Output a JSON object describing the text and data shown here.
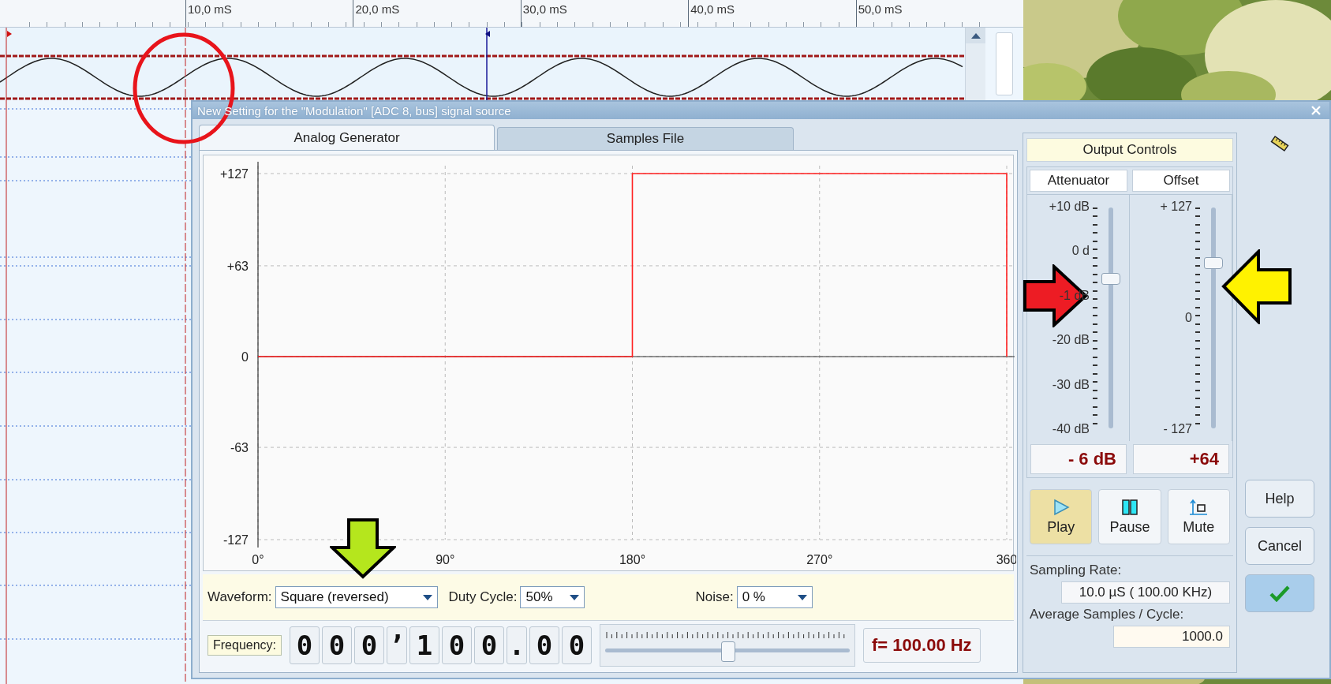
{
  "viewer": {
    "ruler_labels": [
      "10,0 mS",
      "20,0 mS",
      "30,0 mS",
      "40,0 mS",
      "50,0 mS"
    ]
  },
  "dialog": {
    "title": "New Setting for the \"Modulation\" [ADC 8, bus] signal source",
    "tabs": [
      {
        "label": "Analog Generator",
        "selected": true
      },
      {
        "label": "Samples File",
        "selected": false
      }
    ],
    "chart_data": {
      "type": "line",
      "x": [
        0,
        180,
        180,
        360,
        360
      ],
      "grid": true,
      "series": [
        {
          "color": "#ff2020",
          "values": [
            0,
            0,
            127,
            127,
            0
          ]
        }
      ],
      "xlim": [
        0,
        360
      ],
      "ylim": [
        -127,
        127
      ],
      "xticks": [
        {
          "value": 0,
          "label": "0°"
        },
        {
          "value": 90,
          "label": "90°"
        },
        {
          "value": 180,
          "label": "180°"
        },
        {
          "value": 270,
          "label": "270°"
        },
        {
          "value": 360,
          "label": "360"
        }
      ],
      "yticks": [
        {
          "value": 127,
          "label": "+127"
        },
        {
          "value": 63,
          "label": "+63"
        },
        {
          "value": 0,
          "label": "0"
        },
        {
          "value": -63,
          "label": "-63"
        },
        {
          "value": -127,
          "label": "-127"
        }
      ]
    },
    "settings": [
      {
        "label": "Waveform:",
        "value": "Square (reversed)"
      },
      {
        "label": "Duty Cycle:",
        "value": "50%"
      },
      {
        "label": "Noise:",
        "value": "0 %"
      }
    ],
    "frequency": {
      "label": "Frequency:",
      "digits": [
        {
          "char": "0",
          "kind": "digit"
        },
        {
          "char": "0",
          "kind": "digit"
        },
        {
          "char": "0",
          "kind": "digit"
        },
        {
          "char": "’",
          "kind": "separator"
        },
        {
          "char": "1",
          "kind": "digit"
        },
        {
          "char": "0",
          "kind": "digit"
        },
        {
          "char": "0",
          "kind": "digit"
        },
        {
          "char": ".",
          "kind": "separator"
        },
        {
          "char": "0",
          "kind": "digit"
        },
        {
          "char": "0",
          "kind": "digit"
        }
      ],
      "level": 0.5,
      "reading": "f= 100.00 Hz"
    },
    "output_controls": {
      "title": "Output Controls",
      "channels": [
        {
          "name": "Attenuator",
          "scale": [
            "+10 dB",
            "0 d",
            "-1 dB",
            "-20 dB",
            "-30 dB",
            "-40 dB"
          ],
          "level": 0.68,
          "reading": "- 6 dB"
        },
        {
          "name": "Offset",
          "scale": [
            "+ 127",
            "0",
            "- 127"
          ],
          "level": 0.75,
          "reading": "+64"
        }
      ]
    },
    "transport": [
      {
        "label": "Play",
        "kind": "play",
        "selected": true
      },
      {
        "label": "Pause",
        "kind": "pause",
        "selected": false
      },
      {
        "label": "Mute",
        "kind": "mute",
        "selected": false
      }
    ],
    "sampling_rate": {
      "label": "Sampling Rate:",
      "value": "10.0 µS ( 100.00 KHz)"
    },
    "average_samples": {
      "label": "Average Samples / Cycle:",
      "value": "1000.0"
    },
    "buttons": [
      {
        "kind": "text",
        "label": "Help"
      },
      {
        "kind": "text",
        "label": "Cancel"
      },
      {
        "kind": "confirm"
      }
    ]
  }
}
